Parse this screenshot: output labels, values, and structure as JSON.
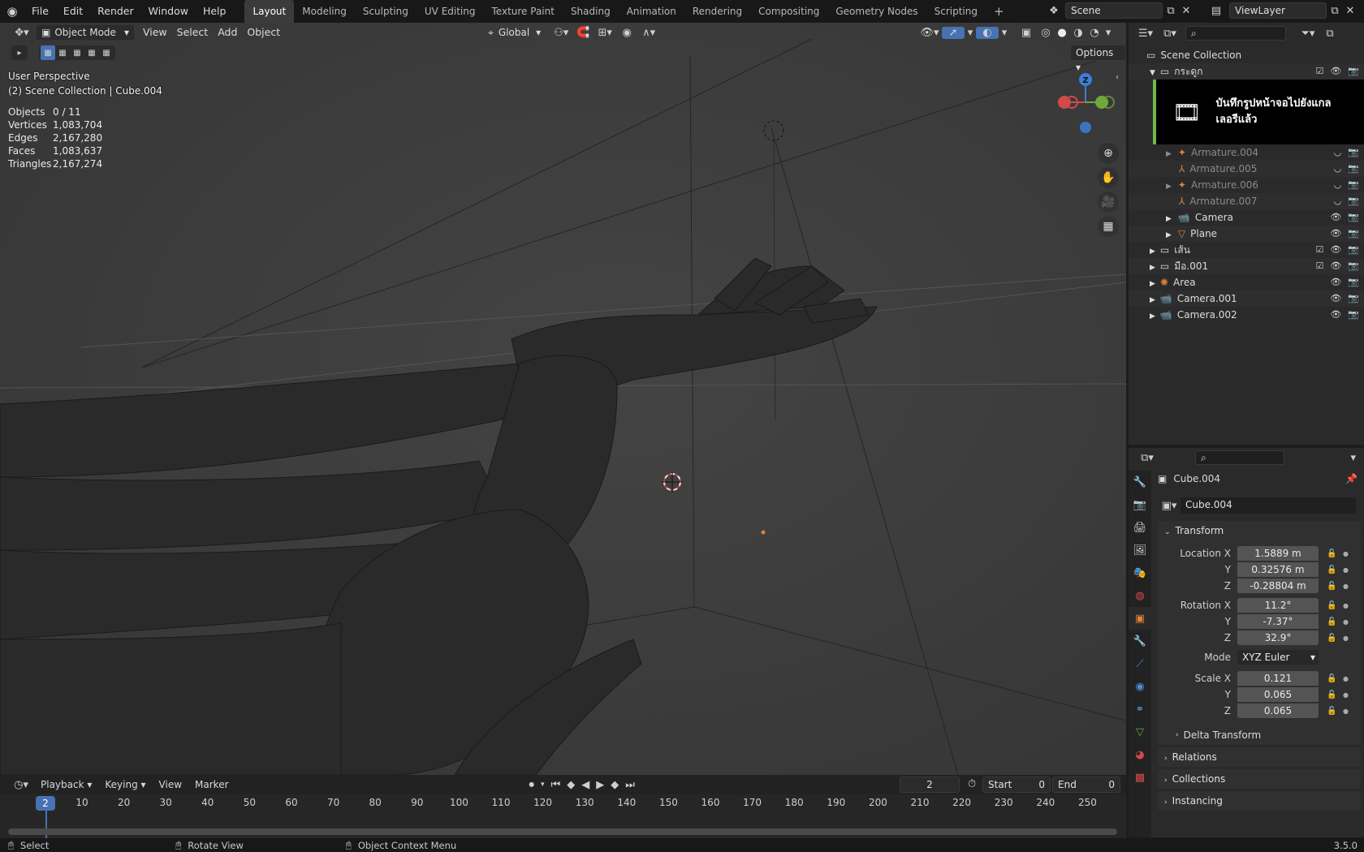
{
  "topbar": {
    "menus": [
      "File",
      "Edit",
      "Render",
      "Window",
      "Help"
    ],
    "workspaces": [
      "Layout",
      "Modeling",
      "Sculpting",
      "UV Editing",
      "Texture Paint",
      "Shading",
      "Animation",
      "Rendering",
      "Compositing",
      "Geometry Nodes",
      "Scripting"
    ],
    "active_workspace": "Layout",
    "scene": "Scene",
    "view_layer": "ViewLayer"
  },
  "viewport": {
    "mode": "Object Mode",
    "menus": [
      "View",
      "Select",
      "Add",
      "Object"
    ],
    "orientation": "Global",
    "options_label": "Options",
    "perspective": "User Perspective",
    "context": "(2) Scene Collection | Cube.004",
    "stats": [
      {
        "key": "Objects",
        "value": "0 / 11"
      },
      {
        "key": "Vertices",
        "value": "1,083,704"
      },
      {
        "key": "Edges",
        "value": "2,167,280"
      },
      {
        "key": "Faces",
        "value": "1,083,637"
      },
      {
        "key": "Triangles",
        "value": "2,167,274"
      }
    ],
    "gizmo": {
      "z": "Z"
    }
  },
  "notification": {
    "text_line1": "บันทึกรูปหน้าจอไปยังแกล",
    "text_line2": "เลอรีแล้ว"
  },
  "outliner": {
    "root": "Scene Collection",
    "items": [
      {
        "name": "กระดูก",
        "indent": 1,
        "dim": false
      },
      {
        "name": "Armature.004",
        "indent": 2,
        "dim": true
      },
      {
        "name": "Armature.005",
        "indent": 2,
        "dim": true
      },
      {
        "name": "Armature.006",
        "indent": 2,
        "dim": true
      },
      {
        "name": "Armature.007",
        "indent": 2,
        "dim": true
      },
      {
        "name": "Camera",
        "indent": 2,
        "dim": false
      },
      {
        "name": "Plane",
        "indent": 2,
        "dim": false
      },
      {
        "name": "เส้น",
        "indent": 1,
        "dim": false
      },
      {
        "name": "มือ.001",
        "indent": 1,
        "dim": false
      },
      {
        "name": "Area",
        "indent": 1,
        "dim": false
      },
      {
        "name": "Camera.001",
        "indent": 1,
        "dim": false
      },
      {
        "name": "Camera.002",
        "indent": 1,
        "dim": false
      }
    ]
  },
  "properties": {
    "object_name": "Cube.004",
    "data_name": "Cube.004",
    "transform_label": "Transform",
    "location_label": "Location X",
    "rotation_label": "Rotation X",
    "scale_label": "Scale X",
    "y_label": "Y",
    "z_label": "Z",
    "location": [
      "1.5889 m",
      "0.32576 m",
      "-0.28804 m"
    ],
    "rotation": [
      "11.2°",
      "-7.37°",
      "32.9°"
    ],
    "mode_label": "Mode",
    "mode_value": "XYZ Euler",
    "scale": [
      "0.121",
      "0.065",
      "0.065"
    ],
    "delta_transform": "Delta Transform",
    "sections": [
      "Relations",
      "Collections",
      "Instancing"
    ]
  },
  "timeline": {
    "menus": [
      "Playback",
      "Keying",
      "View",
      "Marker"
    ],
    "current_frame": "2",
    "start_label": "Start",
    "start_value": "0",
    "end_label": "End",
    "end_value": "0",
    "ticks": [
      "10",
      "20",
      "30",
      "40",
      "50",
      "60",
      "70",
      "80",
      "90",
      "100",
      "110",
      "120",
      "130",
      "140",
      "150",
      "160",
      "170",
      "180",
      "190",
      "200",
      "210",
      "220",
      "230",
      "240",
      "250"
    ]
  },
  "statusbar": {
    "select": "Select",
    "rotate": "Rotate View",
    "context_menu": "Object Context Menu",
    "version": "3.5.0"
  },
  "colors": {
    "accent": "#4772b3",
    "object_orange": "#e0823a",
    "notify_green": "#71b84a"
  }
}
